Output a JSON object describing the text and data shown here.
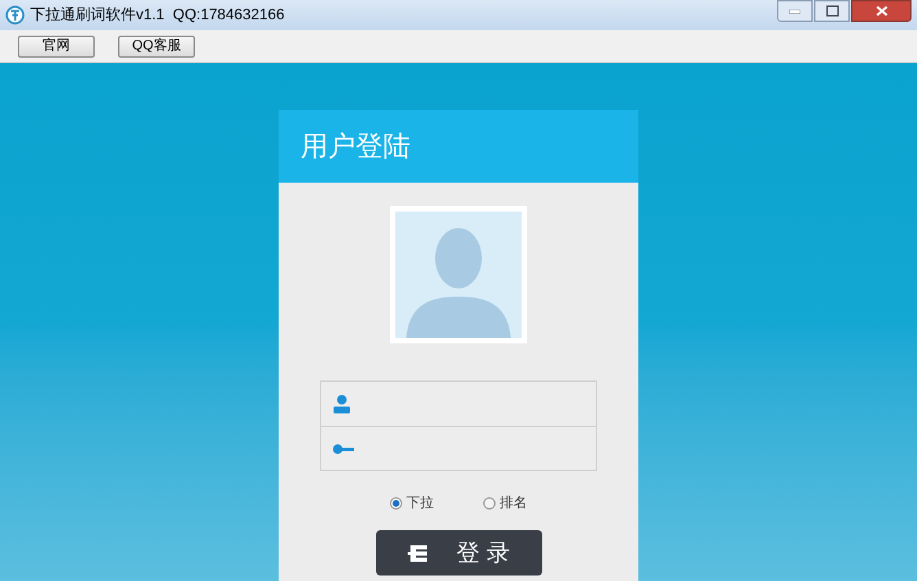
{
  "window": {
    "title": "下拉通刷词软件v1.1  QQ:1784632166"
  },
  "toolbar": [
    "官网",
    "QQ客服"
  ],
  "login": {
    "title": "用户登陆",
    "fields": [
      {
        "kind": "user"
      },
      {
        "kind": "password"
      }
    ],
    "modes": [
      {
        "label": "下拉",
        "selected": true
      },
      {
        "label": "排名",
        "selected": false
      }
    ],
    "button": "登 录"
  }
}
